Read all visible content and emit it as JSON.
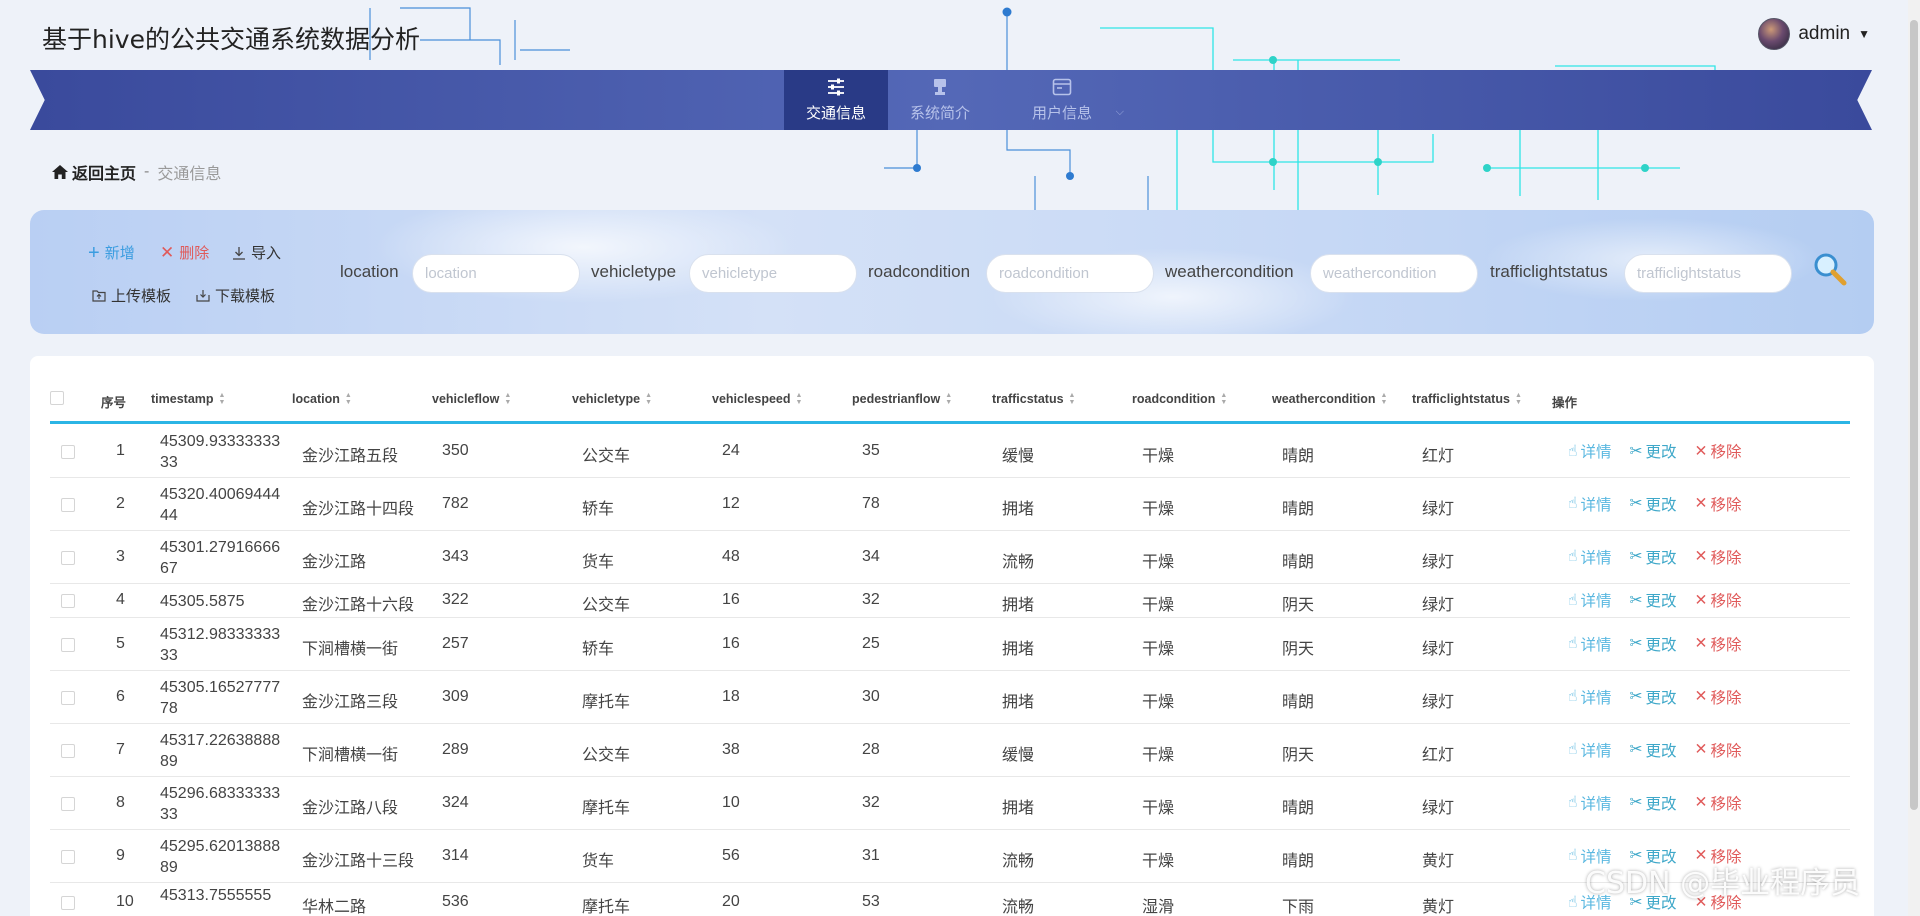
{
  "app": {
    "title": "基于hive的公共交通系统数据分析",
    "user": "admin"
  },
  "nav": [
    {
      "label": "交通信息",
      "icon": "sliders-icon",
      "active": true
    },
    {
      "label": "系统简介",
      "icon": "stamp-icon",
      "active": false
    },
    {
      "label": "用户信息",
      "icon": "browser-window-icon",
      "active": false
    }
  ],
  "breadcrumb": {
    "home": "返回主页",
    "separator": "-",
    "current": "交通信息"
  },
  "toolbar": {
    "add": "新增",
    "delete": "删除",
    "import": "导入",
    "upload_template": "上传模板",
    "download_template": "下载模板"
  },
  "search": {
    "fields": [
      {
        "label": "location",
        "placeholder": "location"
      },
      {
        "label": "vehicletype",
        "placeholder": "vehicletype"
      },
      {
        "label": "roadcondition",
        "placeholder": "roadcondition"
      },
      {
        "label": "weathercondition",
        "placeholder": "weathercondition"
      },
      {
        "label": "trafficlightstatus",
        "placeholder": "trafficlightstatus"
      }
    ]
  },
  "table": {
    "headers": [
      "序号",
      "timestamp",
      "location",
      "vehicleflow",
      "vehicletype",
      "vehiclespeed",
      "pedestrianflow",
      "trafficstatus",
      "roadcondition",
      "weathercondition",
      "trafficlightstatus",
      "操作"
    ],
    "actions": {
      "detail": "详情",
      "edit": "更改",
      "remove": "移除"
    },
    "rows": [
      [
        "1",
        "45309.9333333333",
        "金沙江路五段",
        "350",
        "公交车",
        "24",
        "35",
        "缓慢",
        "干燥",
        "晴朗",
        "红灯"
      ],
      [
        "2",
        "45320.4006944444",
        "金沙江路十四段",
        "782",
        "轿车",
        "12",
        "78",
        "拥堵",
        "干燥",
        "晴朗",
        "绿灯"
      ],
      [
        "3",
        "45301.2791666667",
        "金沙江路",
        "343",
        "货车",
        "48",
        "34",
        "流畅",
        "干燥",
        "晴朗",
        "绿灯"
      ],
      [
        "4",
        "45305.5875",
        "金沙江路十六段",
        "322",
        "公交车",
        "16",
        "32",
        "拥堵",
        "干燥",
        "阴天",
        "绿灯"
      ],
      [
        "5",
        "45312.9833333333",
        "下涧槽横一街",
        "257",
        "轿车",
        "16",
        "25",
        "拥堵",
        "干燥",
        "阴天",
        "绿灯"
      ],
      [
        "6",
        "45305.1652777778",
        "金沙江路三段",
        "309",
        "摩托车",
        "18",
        "30",
        "拥堵",
        "干燥",
        "晴朗",
        "绿灯"
      ],
      [
        "7",
        "45317.2263888889",
        "下涧槽横一街",
        "289",
        "公交车",
        "38",
        "28",
        "缓慢",
        "干燥",
        "阴天",
        "红灯"
      ],
      [
        "8",
        "45296.6833333333",
        "金沙江路八段",
        "324",
        "摩托车",
        "10",
        "32",
        "拥堵",
        "干燥",
        "晴朗",
        "绿灯"
      ],
      [
        "9",
        "45295.6201388889",
        "金沙江路十三段",
        "314",
        "货车",
        "56",
        "31",
        "流畅",
        "干燥",
        "晴朗",
        "黄灯"
      ],
      [
        "10",
        "45313.7555555",
        "华林二路",
        "536",
        "摩托车",
        "20",
        "53",
        "流畅",
        "湿滑",
        "下雨",
        "黄灯"
      ]
    ]
  },
  "watermark": "CSDN @毕业程序员"
}
